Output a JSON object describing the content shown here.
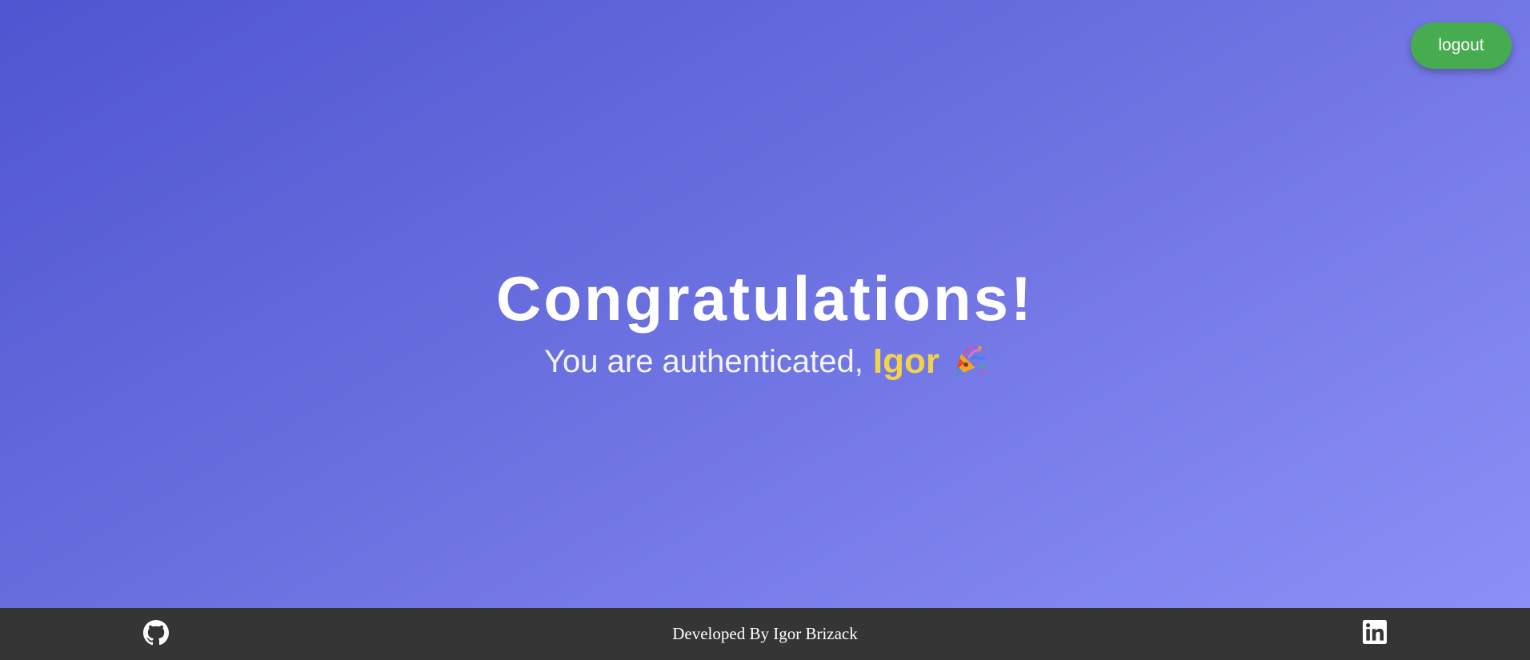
{
  "header": {
    "logout_label": "logout"
  },
  "main": {
    "headline": "Congratulations!",
    "subline_prefix": "You are authenticated,",
    "user_name": "Igor",
    "celebration_icon": "party-popper-icon"
  },
  "footer": {
    "credit": "Developed By Igor Brizack",
    "left_icon": "github-icon",
    "right_icon": "linkedin-icon"
  },
  "colors": {
    "gradient_start": "#4f55d0",
    "gradient_end": "#8b90f7",
    "logout_button": "#47ac4f",
    "user_name": "#f2d34b",
    "footer_bg": "#353535"
  }
}
